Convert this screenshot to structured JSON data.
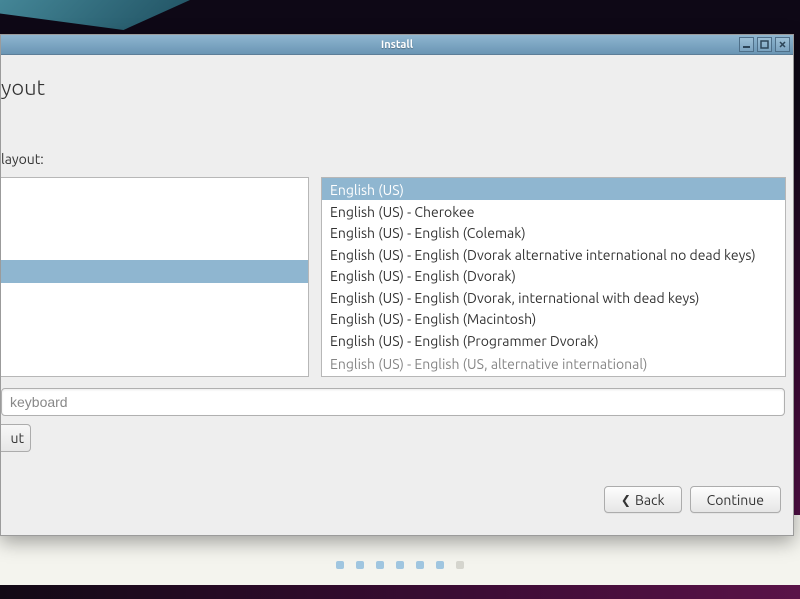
{
  "window": {
    "title": "Install"
  },
  "heading": "yout",
  "instruction": "layout:",
  "variants": [
    {
      "label": "English (US)",
      "selected": true
    },
    {
      "label": "English (US) - Cherokee"
    },
    {
      "label": "English (US) - English (Colemak)"
    },
    {
      "label": "English (US) - English (Dvorak alternative international no dead keys)"
    },
    {
      "label": "English (US) - English (Dvorak)"
    },
    {
      "label": "English (US) - English (Dvorak, international with dead keys)"
    },
    {
      "label": "English (US) - English (Macintosh)"
    },
    {
      "label": "English (US) - English (Programmer Dvorak)"
    },
    {
      "label": "English (US) - English (US, alternative international)",
      "partial": true
    }
  ],
  "test_input": {
    "placeholder": "keyboard"
  },
  "detect_btn": {
    "label": "ut"
  },
  "nav": {
    "back": "Back",
    "continue": "Continue"
  },
  "progress": {
    "total": 7,
    "current": 6
  }
}
